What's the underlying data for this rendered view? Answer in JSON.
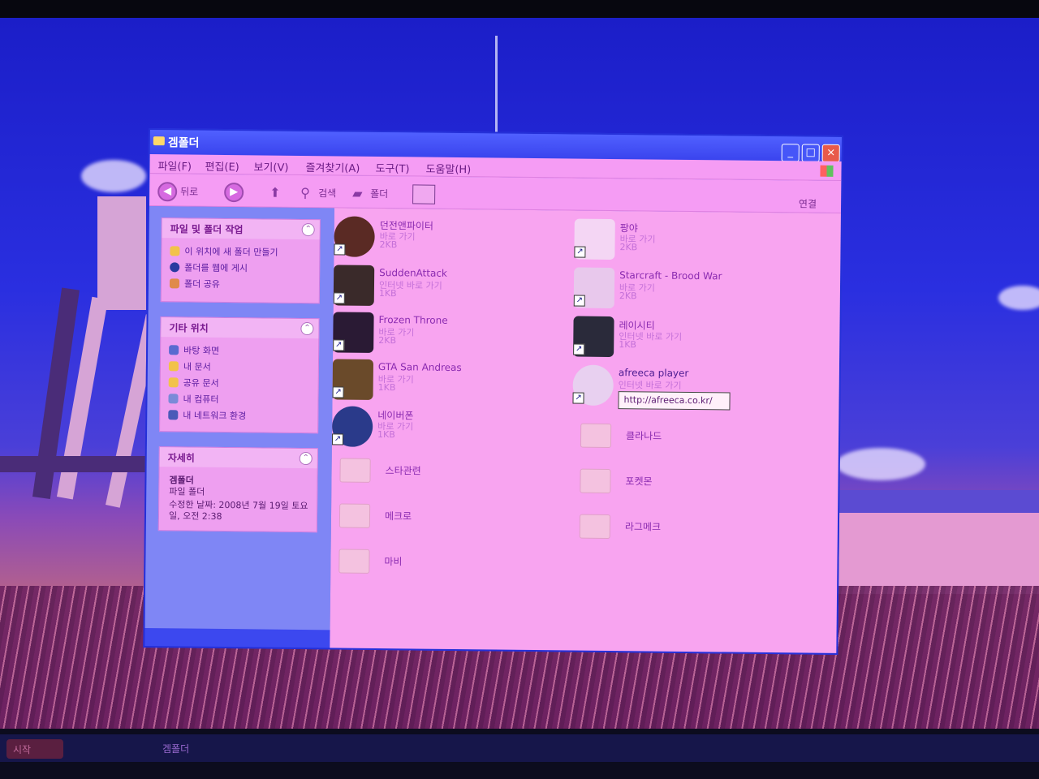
{
  "window": {
    "title": "겜폴더",
    "controls": {
      "minimize": "_",
      "maximize": "□",
      "close": "×"
    }
  },
  "menu": [
    "파일(F)",
    "편집(E)",
    "보기(V)",
    "즐겨찾기(A)",
    "도구(T)",
    "도움말(H)"
  ],
  "toolbar": {
    "back_label": "뒤로",
    "search_label": "검색",
    "folders_label": "폴더",
    "links_label": "연결"
  },
  "taskpane": {
    "file_tasks": {
      "title": "파일 및 폴더 작업",
      "items": [
        "이 위치에 새 폴더 만들기",
        "폴더를 웹에 게시",
        "폴더 공유"
      ]
    },
    "other_places": {
      "title": "기타 위치",
      "items": [
        "바탕 화면",
        "내 문서",
        "공유 문서",
        "내 컴퓨터",
        "내 네트워크 환경"
      ]
    },
    "details": {
      "title": "자세히",
      "name": "겜폴더",
      "type": "파일 폴더",
      "modified": "수정한 날짜: 2008년 7월 19일 토요일, 오전 2:38"
    }
  },
  "files": [
    {
      "name": "던전앤파이터",
      "sub": "바로 가기",
      "size": "2KB",
      "icon": "dnf-icon",
      "color": "#5a2a24"
    },
    {
      "name": "SuddenAttack",
      "sub": "인터넷 바로 가기",
      "size": "1KB",
      "icon": "suddenattack-icon",
      "color": "#3a2a2a"
    },
    {
      "name": "Frozen Throne",
      "sub": "바로 가기",
      "size": "2KB",
      "icon": "frozen-throne-icon",
      "color": "#2a1a34"
    },
    {
      "name": "GTA San Andreas",
      "sub": "바로 가기",
      "size": "1KB",
      "icon": "gta-icon",
      "color": "#6a4a2a"
    },
    {
      "name": "네이버폰",
      "sub": "바로 가기",
      "size": "1KB",
      "icon": "naverphone-icon",
      "color": "#2a3a8a"
    },
    {
      "name": "팡야",
      "sub": "바로 가기",
      "size": "2KB",
      "icon": "pangya-icon",
      "color": "#f4d6f4"
    },
    {
      "name": "Starcraft - Brood War",
      "sub": "바로 가기",
      "size": "2KB",
      "icon": "starcraft-icon",
      "color": "#e8c8ec"
    },
    {
      "name": "레이시티",
      "sub": "인터넷 바로 가기",
      "size": "1KB",
      "icon": "racecity-icon",
      "color": "#2a2a3a"
    },
    {
      "name": "afreeca player",
      "sub": "인터넷 바로 가기",
      "size": "",
      "icon": "afreeca-icon",
      "color": "#e8d0f0"
    }
  ],
  "folders": [
    "스타관련",
    "메크로",
    "마비",
    "클라나드",
    "포켓몬",
    "라그메크"
  ],
  "tooltip": "http://afreeca.co.kr/",
  "taskbar": {
    "start": "시작",
    "task": "겜폴더"
  }
}
